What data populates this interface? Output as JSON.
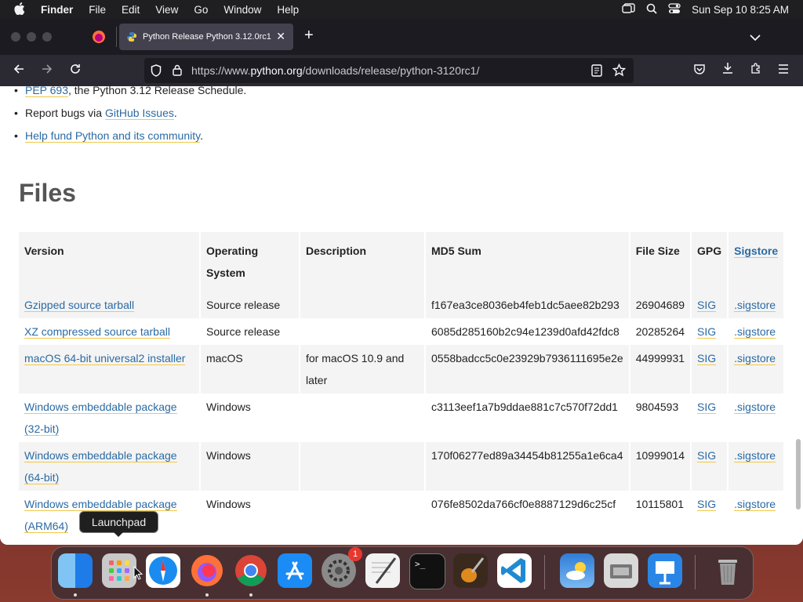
{
  "menubar": {
    "app": "Finder",
    "items": [
      "File",
      "Edit",
      "View",
      "Go",
      "Window",
      "Help"
    ],
    "clock": "Sun Sep 10  8:25 AM",
    "icons": [
      "apple-icon",
      "window-icon",
      "search-icon",
      "control-center-icon"
    ]
  },
  "browser": {
    "tab_title": "Python Release Python 3.12.0rc1",
    "new_tab": "+",
    "url_prefix": "https://www.",
    "url_domain": "python.org",
    "url_path": "/downloads/release/python-3120rc1/"
  },
  "page": {
    "bullets": [
      {
        "link": "PEP 693",
        "text": ", the Python 3.12 Release Schedule."
      },
      {
        "pre": "Report bugs via ",
        "link": "GitHub Issues",
        "text": "."
      },
      {
        "link": "Help fund Python and its community",
        "text": "."
      }
    ],
    "files_heading": "Files",
    "table": {
      "headers": [
        "Version",
        "Operating System",
        "Description",
        "MD5 Sum",
        "File Size",
        "GPG",
        "Sigstore"
      ],
      "rows": [
        {
          "version": "Gzipped source tarball",
          "os": "Source release",
          "desc": "",
          "md5": "f167ea3ce8036eb4feb1dc5aee82b293",
          "size": "26904689",
          "gpg": "SIG",
          "sig": ".sigstore"
        },
        {
          "version": "XZ compressed source tarball",
          "os": "Source release",
          "desc": "",
          "md5": "6085d285160b2c94e1239d0afd42fdc8",
          "size": "20285264",
          "gpg": "SIG",
          "sig": ".sigstore"
        },
        {
          "version": "macOS 64-bit universal2 installer",
          "os": "macOS",
          "desc": "for macOS 10.9 and later",
          "md5": "0558badcc5c0e23929b7936111695e2e",
          "size": "44999931",
          "gpg": "SIG",
          "sig": ".sigstore"
        },
        {
          "version": "Windows embeddable package (32-bit)",
          "os": "Windows",
          "desc": "",
          "md5": "c3113eef1a7b9ddae881c7c570f72dd1",
          "size": "9804593",
          "gpg": "SIG",
          "sig": ".sigstore"
        },
        {
          "version": "Windows embeddable package (64-bit)",
          "os": "Windows",
          "desc": "",
          "md5": "170f06277ed89a34454b81255a1e6ca4",
          "size": "10999014",
          "gpg": "SIG",
          "sig": ".sigstore"
        },
        {
          "version": "Windows embeddable package (ARM64)",
          "os": "Windows",
          "desc": "",
          "md5": "076fe8502da766cf0e8887129d6c25cf",
          "size": "10115801",
          "gpg": "SIG",
          "sig": ".sigstore"
        }
      ]
    }
  },
  "dock": {
    "tooltip": "Launchpad",
    "badge": "1",
    "apps": [
      "finder",
      "launchpad",
      "safari",
      "firefox",
      "chrome",
      "app-store",
      "system-settings",
      "textedit",
      "terminal",
      "garageband",
      "vscode",
      "weather",
      "migration-assistant",
      "keynote",
      "trash"
    ],
    "colors": {
      "finder": "#1e7ce8",
      "launchpad": "#c9c9c9",
      "safari": "#1a8cf0",
      "firefox": "#ff7139",
      "chrome": "#ffffff",
      "app-store": "#1b8cf5",
      "system-settings": "#8a8a8a",
      "textedit": "#f2f2f2",
      "terminal": "#111111",
      "garageband": "#e08a1e",
      "vscode": "#ffffff",
      "weather": "#2f7dd8",
      "migration-assistant": "#d9d9d9",
      "keynote": "#2a86e6",
      "trash": "#9a9a9a"
    }
  }
}
